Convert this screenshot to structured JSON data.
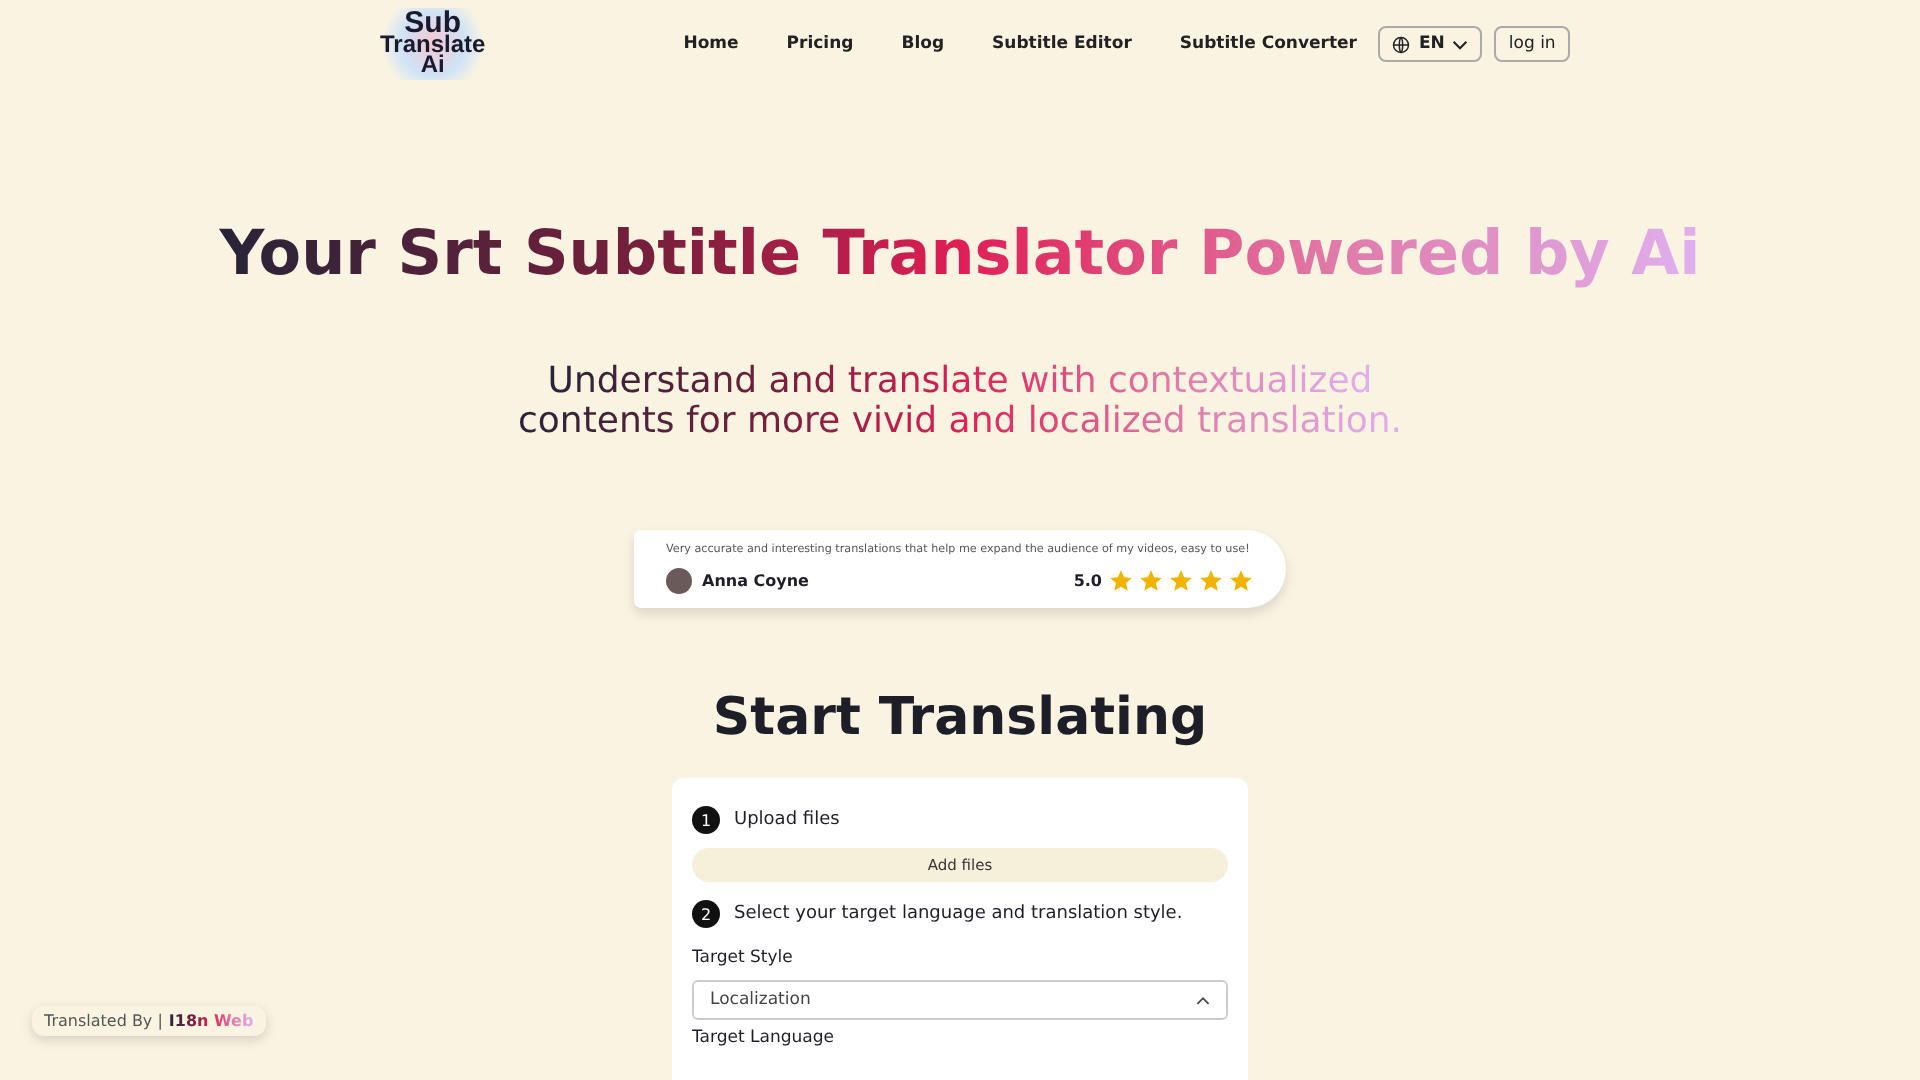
{
  "header": {
    "logo": [
      "Sub",
      "Translate",
      "Ai"
    ],
    "nav": [
      "Home",
      "Pricing",
      "Blog",
      "Subtitle Editor",
      "Subtitle Converter"
    ],
    "language": "EN",
    "login": "log in"
  },
  "hero": {
    "title": "Your Srt Subtitle Translator Powered by Ai",
    "subtitle_lines": [
      "Understand and translate with contextualized",
      "contents for more vivid and localized translation."
    ]
  },
  "review": {
    "quote": "Very accurate and interesting translations that help me expand the audience of my videos, easy to use!",
    "author": "Anna Coyne",
    "score": "5.0",
    "stars": 5
  },
  "section_title": "Start Translating",
  "steps": [
    {
      "number": "1",
      "label": "Upload files"
    },
    {
      "number": "2",
      "label": "Select your target language and translation style."
    }
  ],
  "add_files": "Add files",
  "target_style": {
    "label": "Target Style",
    "value": "Localization",
    "expanded": true
  },
  "target_language_label": "Target Language",
  "badge": {
    "prefix": "Translated By |",
    "brand": "I18n Web"
  }
}
